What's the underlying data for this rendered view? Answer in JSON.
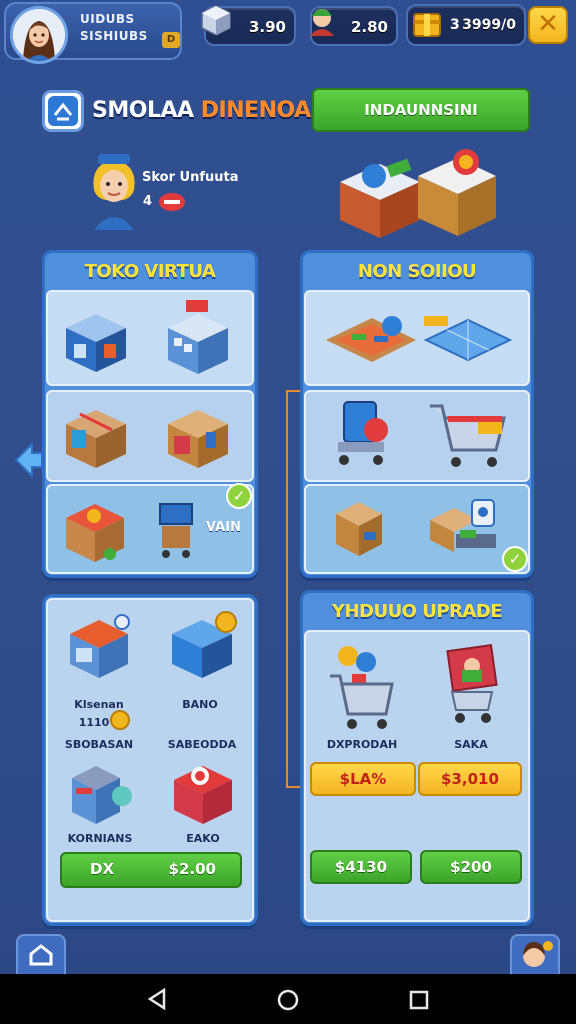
{
  "profile": {
    "name": "UIDUBS",
    "subtitle": "SISHIUBS",
    "level_badge": "D"
  },
  "currencies": [
    {
      "icon": "cube-icon",
      "value": "3.90"
    },
    {
      "icon": "character-icon",
      "value": "2.80"
    },
    {
      "icon": "gold-crate-icon",
      "value": "3",
      "value2": "3999/0"
    }
  ],
  "close_label": "✕",
  "title": {
    "part1": "SMOLAA",
    "part2": "DINENOAI"
  },
  "header_button": "INDAUNNSINI",
  "character": {
    "name": "Skor Unfuuta",
    "level": "4"
  },
  "panels": {
    "left_top": {
      "title": "TOKO VIRTUA",
      "vani_label": "VAIN"
    },
    "right_top": {
      "title": "NON SOIIOU"
    },
    "right_bottom": {
      "title": "YHDUUO UPRADE",
      "items": [
        {
          "label": "DXPRODAH"
        },
        {
          "label": "SAKA"
        }
      ],
      "prices_yellow": [
        "$LA%",
        "$3,010"
      ],
      "prices_green": [
        "$4130",
        "$200"
      ]
    },
    "left_bottom": {
      "items": [
        {
          "title": "Klsenan",
          "subtitle": "1110",
          "label": "SBOBASAN"
        },
        {
          "label_top": "BANO",
          "label": "SABEODDA"
        },
        {
          "label": "KORNIANS"
        },
        {
          "label": "EAKO"
        }
      ],
      "button_left": "DX",
      "button_right": "$2.00"
    }
  },
  "colors": {
    "accent_yellow": "#ffe338",
    "accent_green": "#4bbb35",
    "panel_blue": "#4f8fdc",
    "connector": "#e58a2e"
  }
}
